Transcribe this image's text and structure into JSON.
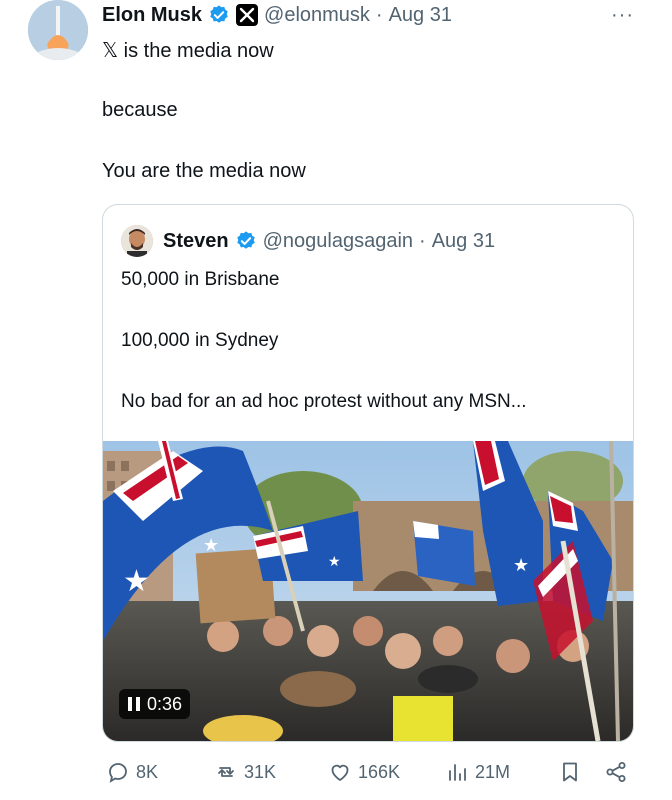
{
  "author": {
    "name": "Elon Musk",
    "handle": "@elonmusk",
    "separator": "·",
    "date": "Aug 31",
    "verified_icon": "verified-badge-icon",
    "affiliation_icon": "x-logo-icon",
    "more_label": "···"
  },
  "tweet": {
    "line1": "𝕏 is the media now",
    "line2": "because",
    "line3": "You are the media now"
  },
  "quoted": {
    "name": "Steven",
    "handle": "@nogulagsagain",
    "separator": "·",
    "date": "Aug 31",
    "line1": "50,000 in Brisbane",
    "line2": "100,000 in Sydney",
    "line3": "No bad for an ad hoc protest without any MSN...",
    "video_duration": "0:36",
    "media_description_icon": "video-thumbnail"
  },
  "actions": {
    "replies": "8K",
    "reposts": "31K",
    "likes": "166K",
    "views": "21M"
  },
  "colors": {
    "accent": "#1d9bf0",
    "secondary_text": "#536471",
    "border": "#cfd9de"
  }
}
